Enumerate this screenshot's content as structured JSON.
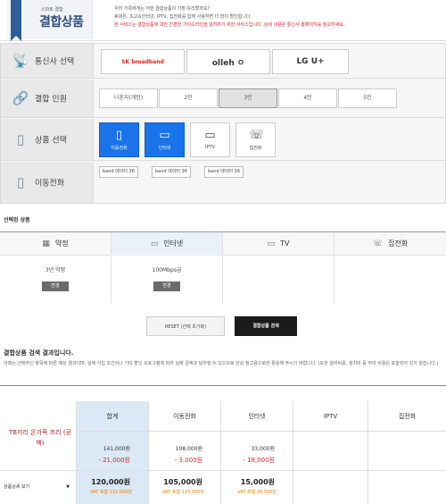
{
  "header": {
    "logo_sub": "스마트 결합",
    "logo_title": "결합상품",
    "notice_lines": [
      "우리 가족에게는 어떤 결합상품이 가장 유리할까요?",
      "휴대폰, 초고속인터넷, IPTV, 집전화를 함께 사용하면 더 많이 할인됩니다.",
      "본 서비스는 결합상품에 대한 간편한 가이드라인을 알려주기 위한 서비스입니다. 상세 내용은 통신사 홈페이지를 참고하세요."
    ]
  },
  "panel": {
    "carrier_label": "통신사 선택",
    "carriers": [
      {
        "name": "SK broadband",
        "color": "#e2231a"
      },
      {
        "name": "olleh ㅇ",
        "color": "#e2231a"
      },
      {
        "name": "LG U+",
        "color": "#c8102e"
      }
    ],
    "count_label": "결합 인원",
    "counts": [
      "나혼자(개인)",
      "2인",
      "3인",
      "4인",
      "5인"
    ],
    "count_selected": "3인",
    "product_label": "상품 선택",
    "products": [
      {
        "name": "이동전화",
        "selected": true,
        "icon": "mobile-icon"
      },
      {
        "name": "인터넷",
        "selected": true,
        "icon": "internet-icon"
      },
      {
        "name": "IPTV",
        "selected": false,
        "icon": "tv-icon"
      },
      {
        "name": "집전화",
        "selected": false,
        "icon": "phone-icon"
      }
    ],
    "mobile_label": "이동전화",
    "bands": [
      "band 데이터 36",
      "band 데이터 36",
      "band 데이터 36"
    ]
  },
  "selected": {
    "title": "선택된 상품",
    "columns": [
      {
        "name": "약정",
        "icon": "calendar-icon"
      },
      {
        "name": "인터넷",
        "icon": "internet-icon"
      },
      {
        "name": "TV",
        "icon": "tv-icon"
      },
      {
        "name": "집전화",
        "icon": "phone-icon"
      }
    ],
    "values": [
      {
        "value": "3년 약정",
        "button": "변경"
      },
      {
        "value": "100Mbps급",
        "button": "변경"
      }
    ]
  },
  "buttons": {
    "reset": "RESET (선택 초기화)",
    "search": "결합상품 검색"
  },
  "result": {
    "title": "결합상품 검색 결과입니다.",
    "note": "아래는 선택하신 항목에 따른 예상 결과이며, 실제 가입 조건이나 기타 할인 프로그램에 따라 실제 금액과 달라질 수 있으므로 단순 참고용으로만 활용해 주시기 바랍니다. (또한 설비비용, 설치비 등 부대 비용은 포함되어 있지 않습니다.)",
    "plan_name": "TB끼리 온가족 프리 (공백)",
    "headers": [
      "합계",
      "이동전화",
      "인터넷",
      "IPTV",
      "집전화"
    ],
    "base": [
      "141,000원",
      "108,000원",
      "33,000원"
    ],
    "discount": [
      "- 21,000원",
      "- 3,000원",
      "- 18,000원"
    ],
    "price": [
      "120,000원",
      "105,000원",
      "15,000원"
    ],
    "vat": [
      "VAT 포함 132,000원",
      "VAT 포함 115,500원",
      "VAT 포함 16,500원"
    ],
    "detail_select": "상품상세 보기"
  }
}
